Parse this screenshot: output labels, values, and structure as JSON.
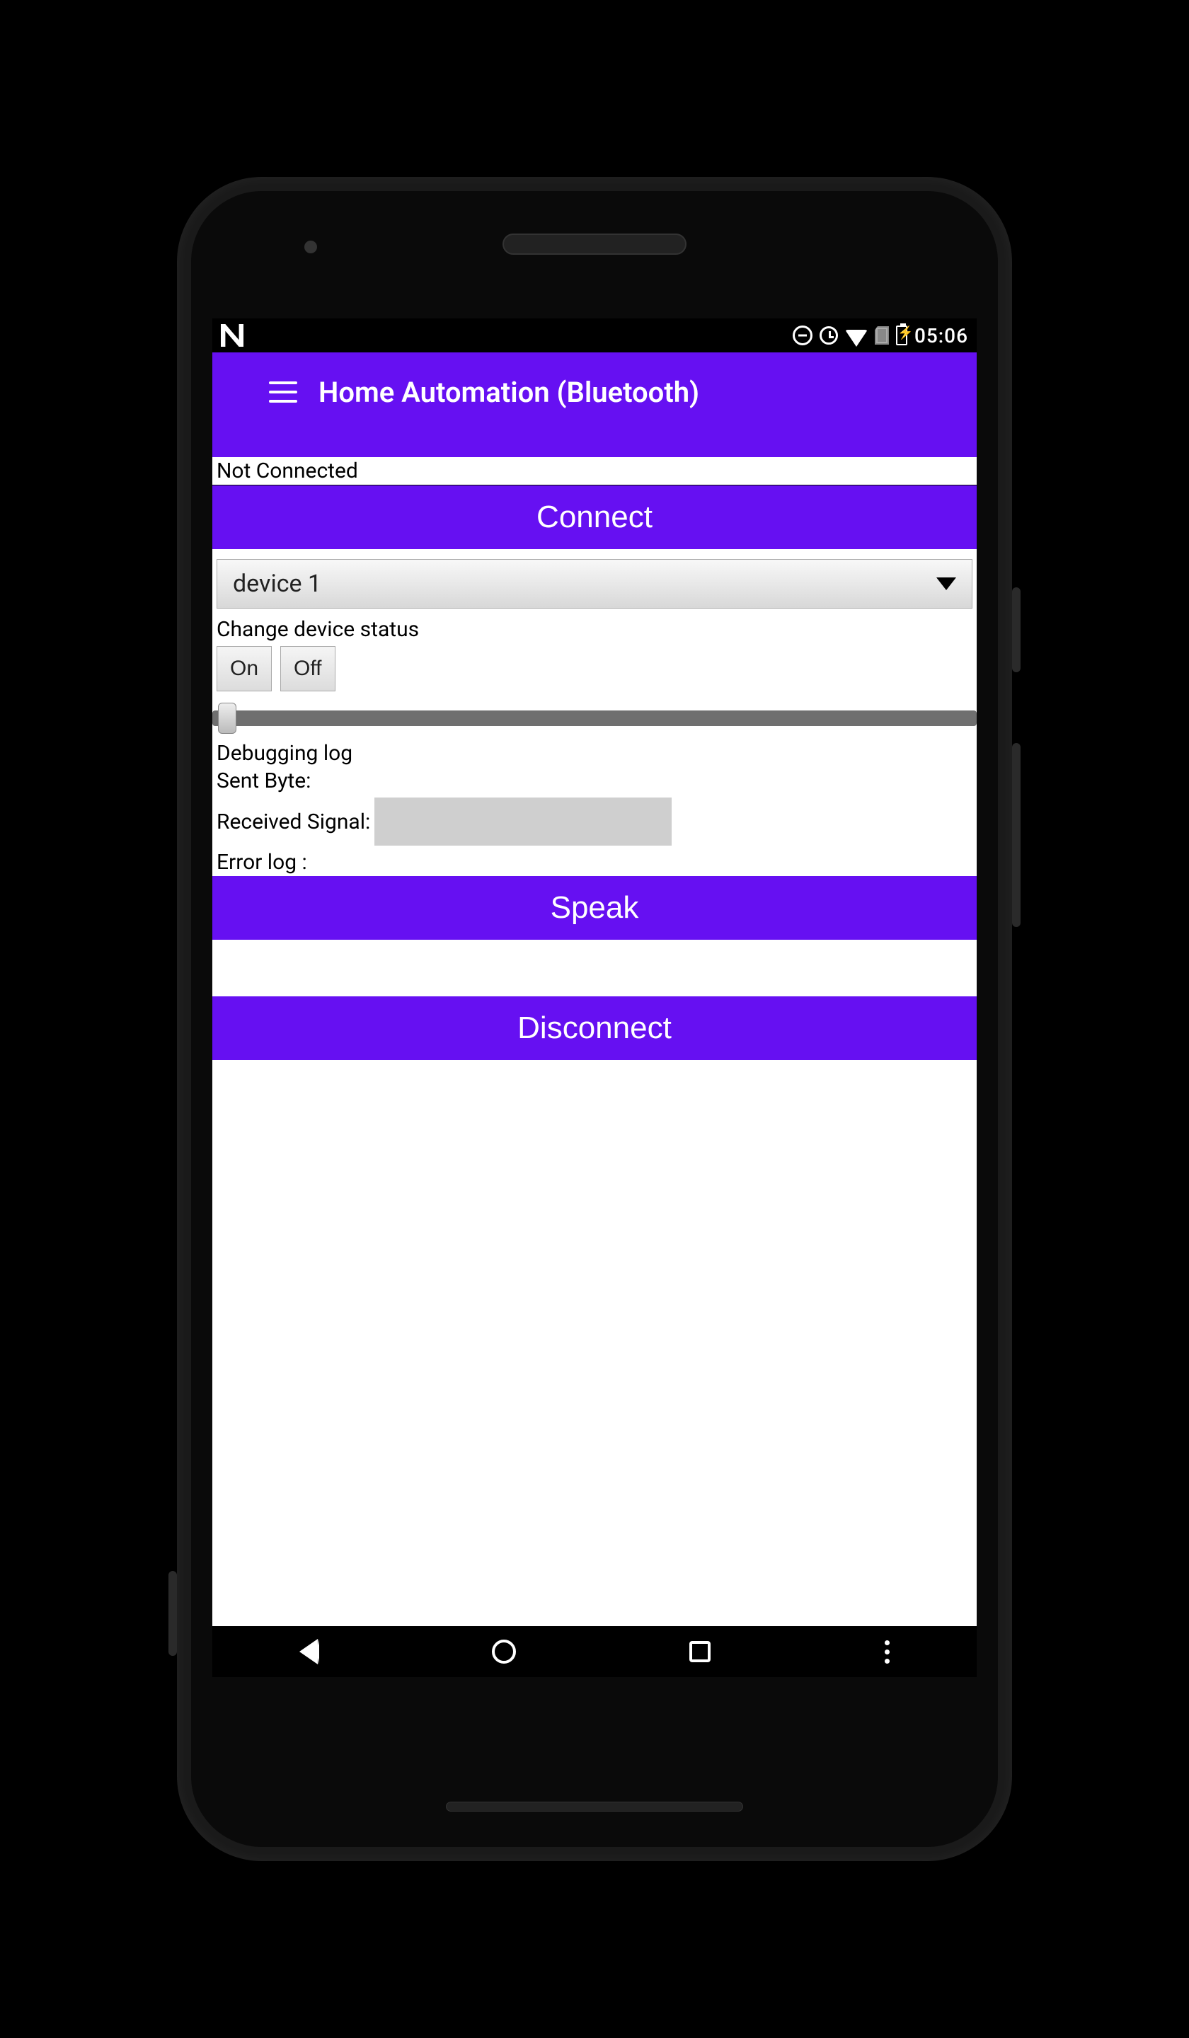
{
  "statusbar": {
    "time": "05:06"
  },
  "appbar": {
    "title": "Home Automation (Bluetooth)"
  },
  "connection": {
    "status": "Not Connected",
    "connect_label": "Connect",
    "disconnect_label": "Disconnect"
  },
  "device_selector": {
    "selected": "device 1"
  },
  "device_status": {
    "heading": "Change device status",
    "on_label": "On",
    "off_label": "Off"
  },
  "debug": {
    "heading": "Debugging log",
    "sent_label": "Sent Byte:",
    "received_label": "Received Signal:",
    "error_label": "Error log :"
  },
  "speak": {
    "label": "Speak"
  }
}
